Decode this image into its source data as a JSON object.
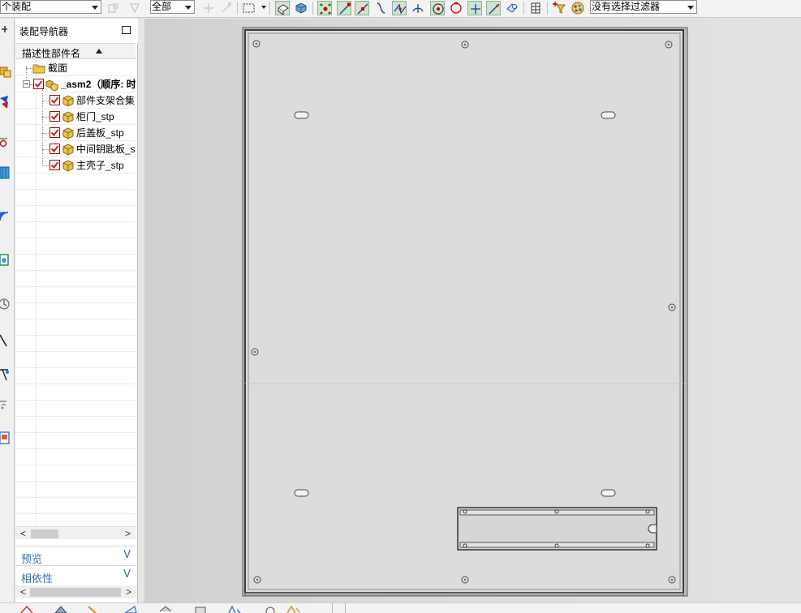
{
  "toolbar": {
    "assembly_filter": "个装配",
    "scope_filter": "全部",
    "selection_filter": "没有选择过滤器"
  },
  "navigator": {
    "title": "装配导航器",
    "column_header": "描述性部件名",
    "sort": "ascending",
    "tree": [
      {
        "label": "截面",
        "type": "folder",
        "checked": null
      },
      {
        "label": "_asm2（顺序: 时",
        "type": "assembly",
        "checked": true,
        "bold": true,
        "expanded": true
      },
      {
        "label": "部件支架合集",
        "type": "component",
        "checked": true
      },
      {
        "label": "柜门_stp",
        "type": "component",
        "checked": true
      },
      {
        "label": "后盖板_stp",
        "type": "component",
        "checked": true
      },
      {
        "label": "中间钥匙板_st",
        "type": "component",
        "checked": true
      },
      {
        "label": "主壳子_stp",
        "type": "component",
        "checked": true
      }
    ],
    "sections": [
      {
        "label": "预览",
        "state": "collapsed"
      },
      {
        "label": "相依性",
        "state": "collapsed"
      }
    ]
  },
  "colors": {
    "accent": "#3a6fb4",
    "checkbox_red": "#d11a1a",
    "component_gold": "#e8b53a",
    "canvas_bg": "#d8d8d8",
    "part_face": "#dcdcdc",
    "part_edge": "#3c3c3c"
  }
}
